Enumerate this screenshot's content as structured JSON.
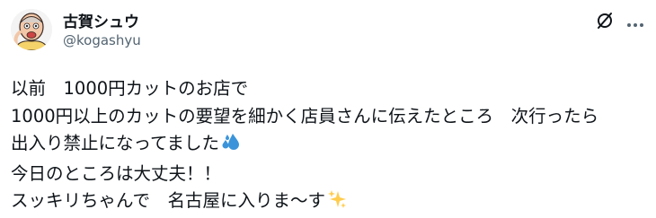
{
  "author": {
    "name": "古賀シュウ",
    "handle": "@kogashyu"
  },
  "icons": {
    "avatar": "caricature-avatar",
    "grok": "grok-icon",
    "more": "more-options-icon",
    "sweat": "sweat-droplets-emoji",
    "sparkles": "sparkles-emoji"
  },
  "colors": {
    "text": "#0f1419",
    "secondary": "#536471",
    "sweat": "#3b94d9",
    "sparkles": "#ffcc4d"
  },
  "post": {
    "lines": [
      "以前　1000円カットのお店で",
      "1000円以上のカットの要望を細かく店員さんに伝えたところ　次行ったら",
      "出入り禁止になってました",
      "今日のところは大丈夫！！",
      "スッキリちゃんで　名古屋に入りま～す"
    ]
  }
}
